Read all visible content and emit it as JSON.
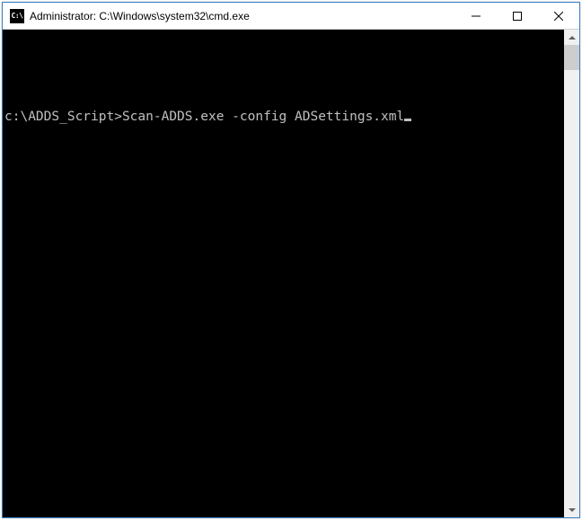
{
  "window": {
    "title": "Administrator: C:\\Windows\\system32\\cmd.exe",
    "icon_label": "C:\\"
  },
  "console": {
    "prompt": "c:\\ADDS_Script>",
    "command": "Scan-ADDS.exe -config ADSettings.xml"
  }
}
